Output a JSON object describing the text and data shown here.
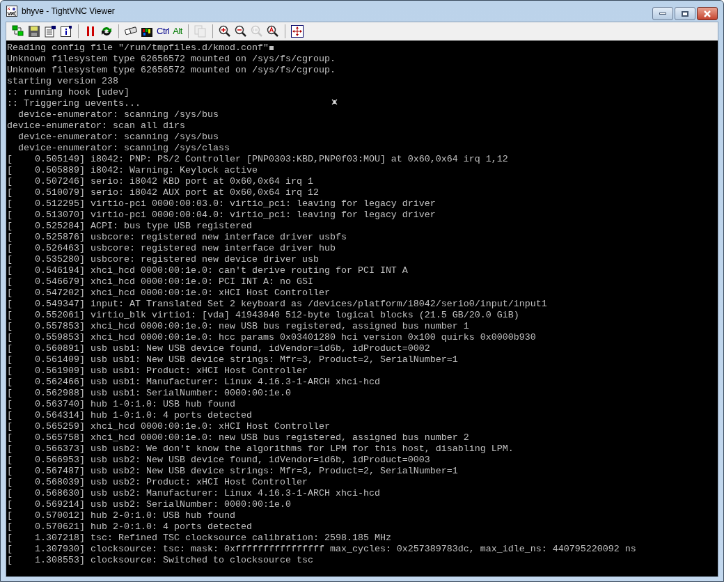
{
  "window": {
    "title": "bhyve - TightVNC Viewer"
  },
  "toolbar": [
    {
      "kind": "icon",
      "disabled": false
    },
    {
      "kind": "icon",
      "disabled": false
    },
    {
      "kind": "icon",
      "disabled": false
    },
    {
      "kind": "icon",
      "disabled": false
    },
    {
      "kind": "separator"
    },
    {
      "kind": "icon",
      "disabled": false
    },
    {
      "kind": "icon",
      "disabled": false
    },
    {
      "kind": "separator"
    },
    {
      "kind": "icon",
      "disabled": false
    },
    {
      "kind": "icon",
      "disabled": false
    },
    {
      "kind": "text",
      "label": "Ctrl",
      "color": "#00008b",
      "disabled": false
    },
    {
      "kind": "text",
      "label": "Alt",
      "color": "#007a00",
      "disabled": false
    },
    {
      "kind": "separator"
    },
    {
      "kind": "icon",
      "disabled": true
    },
    {
      "kind": "separator"
    },
    {
      "kind": "icon",
      "disabled": false
    },
    {
      "kind": "icon",
      "disabled": false
    },
    {
      "kind": "icon",
      "disabled": true
    },
    {
      "kind": "icon",
      "disabled": false
    },
    {
      "kind": "separator"
    },
    {
      "kind": "icon",
      "disabled": false
    }
  ],
  "console": {
    "cursor_visible": true,
    "lines": [
      "Reading config file \"/run/tmpfiles.d/kmod.conf\"",
      "Unknown filesystem type 62656572 mounted on /sys/fs/cgroup.",
      "Unknown filesystem type 62656572 mounted on /sys/fs/cgroup.",
      "starting version 238",
      ":: running hook [udev]",
      ":: Triggering uevents...",
      "  device-enumerator: scanning /sys/bus",
      "device-enumerator: scan all dirs",
      "  device-enumerator: scanning /sys/bus",
      "  device-enumerator: scanning /sys/class",
      "[    0.505149] i8042: PNP: PS/2 Controller [PNP0303:KBD,PNP0f03:MOU] at 0x60,0x64 irq 1,12",
      "[    0.505889] i8042: Warning: Keylock active",
      "[    0.507246] serio: i8042 KBD port at 0x60,0x64 irq 1",
      "[    0.510079] serio: i8042 AUX port at 0x60,0x64 irq 12",
      "[    0.512295] virtio-pci 0000:00:03.0: virtio_pci: leaving for legacy driver",
      "[    0.513070] virtio-pci 0000:00:04.0: virtio_pci: leaving for legacy driver",
      "[    0.525284] ACPI: bus type USB registered",
      "[    0.525876] usbcore: registered new interface driver usbfs",
      "[    0.526463] usbcore: registered new interface driver hub",
      "[    0.535280] usbcore: registered new device driver usb",
      "[    0.546194] xhci_hcd 0000:00:1e.0: can't derive routing for PCI INT A",
      "[    0.546679] xhci_hcd 0000:00:1e.0: PCI INT A: no GSI",
      "[    0.547202] xhci_hcd 0000:00:1e.0: xHCI Host Controller",
      "[    0.549347] input: AT Translated Set 2 keyboard as /devices/platform/i8042/serio0/input/input1",
      "[    0.552061] virtio_blk virtio1: [vda] 41943040 512-byte logical blocks (21.5 GB/20.0 GiB)",
      "[    0.557853] xhci_hcd 0000:00:1e.0: new USB bus registered, assigned bus number 1",
      "[    0.559853] xhci_hcd 0000:00:1e.0: hcc params 0x03401280 hci version 0x100 quirks 0x0000b930",
      "[    0.560891] usb usb1: New USB device found, idVendor=1d6b, idProduct=0002",
      "[    0.561409] usb usb1: New USB device strings: Mfr=3, Product=2, SerialNumber=1",
      "[    0.561909] usb usb1: Product: xHCI Host Controller",
      "[    0.562466] usb usb1: Manufacturer: Linux 4.16.3-1-ARCH xhci-hcd",
      "[    0.562988] usb usb1: SerialNumber: 0000:00:1e.0",
      "[    0.563740] hub 1-0:1.0: USB hub found",
      "[    0.564314] hub 1-0:1.0: 4 ports detected",
      "[    0.565259] xhci_hcd 0000:00:1e.0: xHCI Host Controller",
      "[    0.565758] xhci_hcd 0000:00:1e.0: new USB bus registered, assigned bus number 2",
      "[    0.566373] usb usb2: We don't know the algorithms for LPM for this host, disabling LPM.",
      "[    0.566953] usb usb2: New USB device found, idVendor=1d6b, idProduct=0003",
      "[    0.567487] usb usb2: New USB device strings: Mfr=3, Product=2, SerialNumber=1",
      "[    0.568039] usb usb2: Product: xHCI Host Controller",
      "[    0.568630] usb usb2: Manufacturer: Linux 4.16.3-1-ARCH xhci-hcd",
      "[    0.569214] usb usb2: SerialNumber: 0000:00:1e.0",
      "[    0.570012] hub 2-0:1.0: USB hub found",
      "[    0.570621] hub 2-0:1.0: 4 ports detected",
      "[    1.307218] tsc: Refined TSC clocksource calibration: 2598.185 MHz",
      "[    1.307930] clocksource: tsc: mask: 0xffffffffffffffff max_cycles: 0x257389783dc, max_idle_ns: 440795220092 ns",
      "[    1.308553] clocksource: Switched to clocksource tsc"
    ]
  }
}
